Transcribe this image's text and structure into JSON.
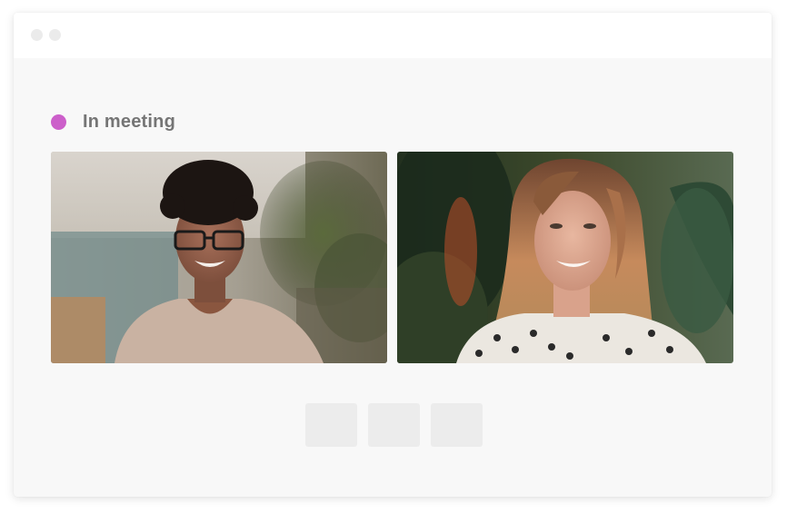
{
  "window": {
    "status": {
      "label": "In meeting",
      "color": "#cc5fca"
    },
    "participants": [
      {
        "name": "participant-1"
      },
      {
        "name": "participant-2"
      }
    ],
    "controls": [
      {
        "name": "control-1"
      },
      {
        "name": "control-2"
      },
      {
        "name": "control-3"
      }
    ]
  }
}
